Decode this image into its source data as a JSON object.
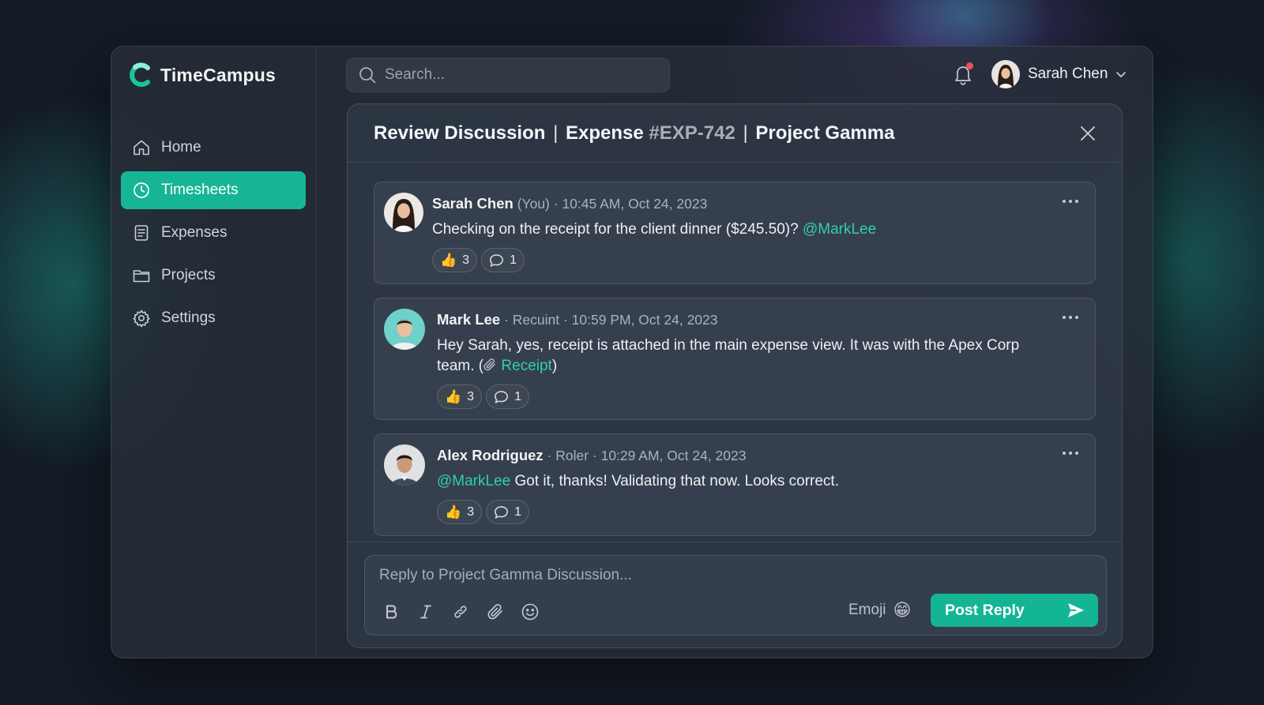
{
  "app": {
    "brand": "TimeCampus",
    "accent": "#16b596"
  },
  "sidebar": {
    "items": [
      {
        "label": "Home",
        "icon": "home-icon",
        "active": false
      },
      {
        "label": "Timesheets",
        "icon": "clock-icon",
        "active": true
      },
      {
        "label": "Expenses",
        "icon": "receipt-icon",
        "active": false
      },
      {
        "label": "Projects",
        "icon": "folder-icon",
        "active": false
      },
      {
        "label": "Settings",
        "icon": "gear-icon",
        "active": false
      }
    ]
  },
  "topbar": {
    "search_placeholder": "Search...",
    "user_name": "Sarah Chen",
    "notification_badge": true
  },
  "panel": {
    "title_part1": "Review Discussion",
    "title_part2": "Expense",
    "title_code": "#EXP-742",
    "title_part3": "Project Gamma",
    "separator": "|"
  },
  "comments": [
    {
      "author": "Sarah Chen",
      "author_suffix": "(You)",
      "meta": "· 10:45 AM, Oct 24, 2023",
      "text": "Checking on the receipt for the client dinner ($245.50)?",
      "mention": "@MarkLee",
      "likes": "3",
      "replies": "1"
    },
    {
      "author": "Mark Lee",
      "meta": "· Recuint · 10:59 PM, Oct 24, 2023",
      "text": "Hey Sarah, yes, receipt is attached in the main expense view. It was with the Apex Corp team. (",
      "link": "Receipt",
      "text_end": ")",
      "likes": "3",
      "replies": "1"
    },
    {
      "author": "Alex Rodriguez",
      "meta": "· Roler · 10:29 AM, Oct 24, 2023",
      "mention": "@MarkLee",
      "text": "Got it, thanks! Validating that now. Looks correct.",
      "likes": "3",
      "replies": "1"
    }
  ],
  "composer": {
    "placeholder": "Reply to Project Gamma Discussion...",
    "emoji_label": "Emoji",
    "emoji_glyph": "😁",
    "post_label": "Post Reply"
  }
}
